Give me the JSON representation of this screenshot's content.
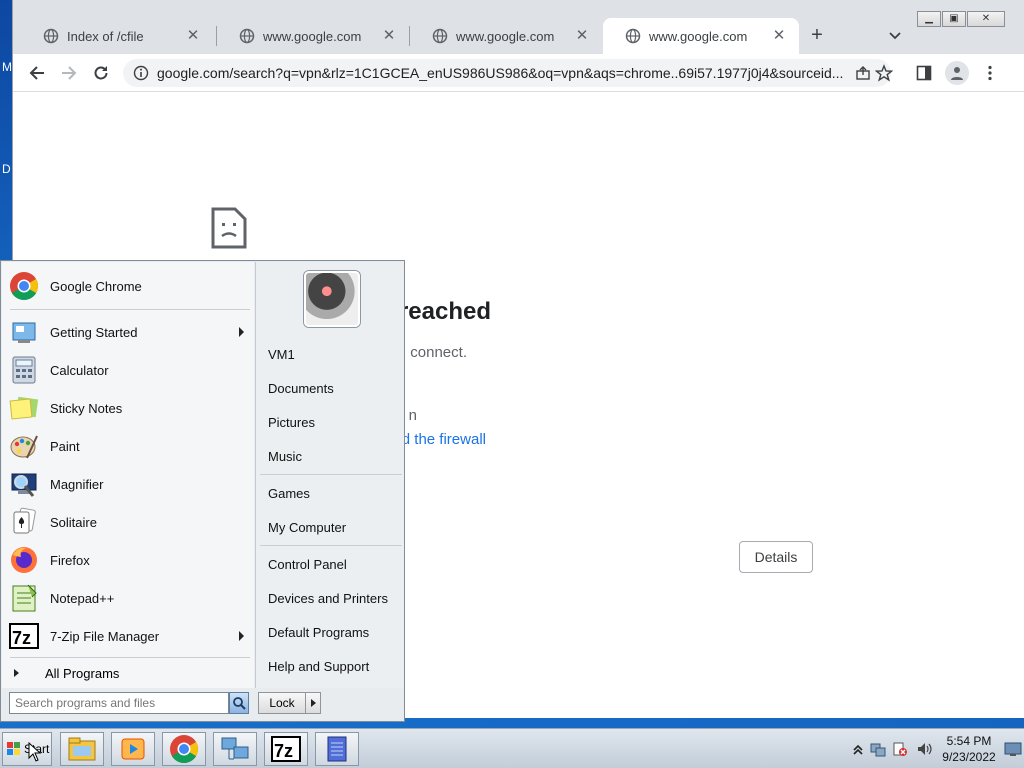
{
  "desktop": {
    "edge_letter_1": "M",
    "edge_letter_2": "D"
  },
  "browser": {
    "tabs": [
      {
        "title": "Index of /cfile",
        "active": false
      },
      {
        "title": "www.google.com",
        "active": false
      },
      {
        "title": "www.google.com",
        "active": false
      },
      {
        "title": "www.google.com",
        "active": true
      }
    ],
    "new_tab_label": "+",
    "close_glyph": "✕",
    "url": "google.com/search?q=vpn&rlz=1C1GCEA_enUS986US986&oq=vpn&aqs=chrome..69i57.1977j0j4&sourceid...",
    "window_controls": {
      "minimize": "▁",
      "restore": "▣",
      "close": "✕"
    }
  },
  "page": {
    "heading_visible": "reached",
    "subtext_visible": "connect.",
    "line3_visible": "n",
    "link_visible": "d the firewall",
    "details_button": "Details"
  },
  "start_menu": {
    "pinned": [
      {
        "label": "Google Chrome",
        "icon": "chrome-icon",
        "arrow": false
      }
    ],
    "programs": [
      {
        "label": "Getting Started",
        "icon": "getting-started-icon",
        "arrow": true
      },
      {
        "label": "Calculator",
        "icon": "calculator-icon",
        "arrow": false
      },
      {
        "label": "Sticky Notes",
        "icon": "sticky-notes-icon",
        "arrow": false
      },
      {
        "label": "Paint",
        "icon": "paint-icon",
        "arrow": false
      },
      {
        "label": "Magnifier",
        "icon": "magnifier-icon",
        "arrow": false
      },
      {
        "label": "Solitaire",
        "icon": "solitaire-icon",
        "arrow": false
      },
      {
        "label": "Firefox",
        "icon": "firefox-icon",
        "arrow": false
      },
      {
        "label": "Notepad++",
        "icon": "notepadpp-icon",
        "arrow": false
      },
      {
        "label": "7-Zip File Manager",
        "icon": "sevenzip-icon",
        "arrow": true
      }
    ],
    "all_programs": "All Programs",
    "search_placeholder": "Search programs and files",
    "right": {
      "user": "VM1",
      "group1": [
        "Documents",
        "Pictures",
        "Music"
      ],
      "group2": [
        "Games",
        "My Computer"
      ],
      "group3": [
        "Control Panel",
        "Devices and Printers",
        "Default Programs",
        "Help and Support"
      ]
    },
    "lock_label": "Lock"
  },
  "taskbar": {
    "start_label": "Start",
    "apps": [
      "explorer-icon",
      "media-player-icon",
      "chrome-icon",
      "network-icon",
      "sevenzip-icon",
      "notepad-icon"
    ],
    "time": "5:54 PM",
    "date": "9/23/2022"
  }
}
